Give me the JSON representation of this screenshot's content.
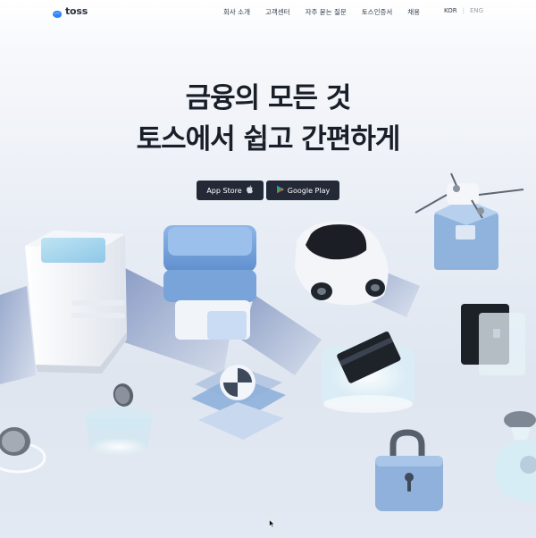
{
  "header": {
    "logo_text": "toss",
    "nav": [
      "회사 소개",
      "고객센터",
      "자주 묻는 질문",
      "토스인증서",
      "채용"
    ],
    "lang_kor": "KOR",
    "lang_sep": "|",
    "lang_eng": "ENG"
  },
  "hero": {
    "line1": "금융의 모든 것",
    "line2": "토스에서 쉽고 간편하게"
  },
  "buttons": {
    "app_store": "App Store",
    "google_play": "Google Play"
  },
  "colors": {
    "brand_blue": "#3182f6",
    "text_dark": "#191f28",
    "button_bg": "#232937"
  },
  "icons": [
    "toss-logo-icon",
    "apple-icon",
    "google-play-icon",
    "mouse-cursor-icon"
  ]
}
